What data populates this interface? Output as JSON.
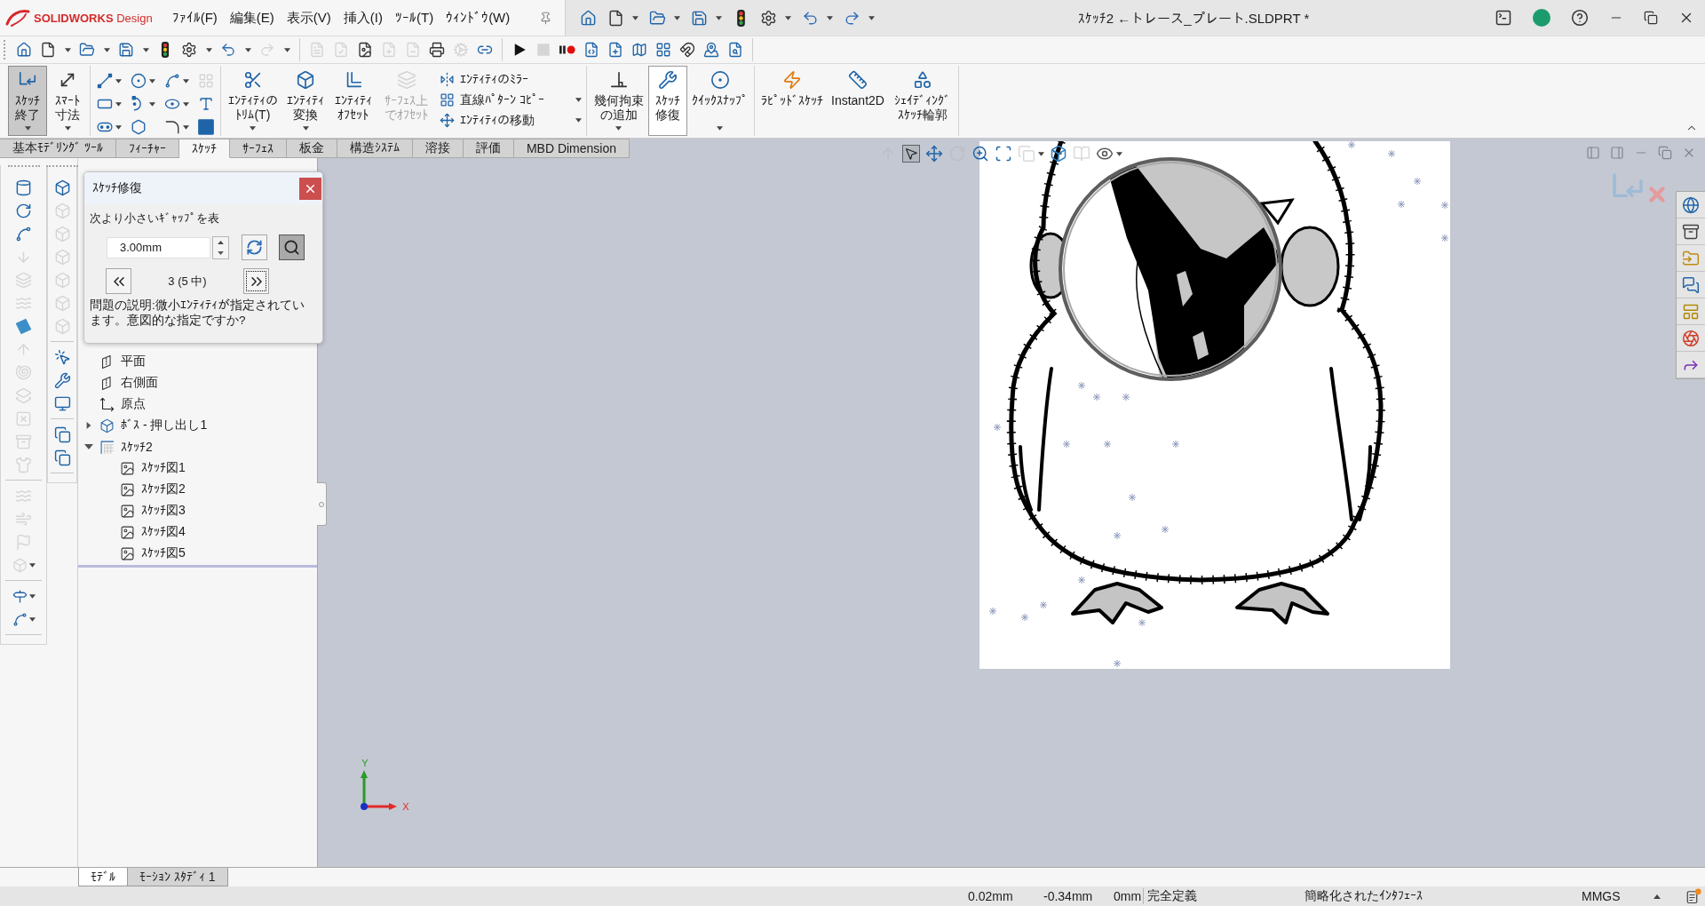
{
  "title_bar": {
    "app_name": "**SOLIDWORKS** Design",
    "menus": [
      "ﾌｧｲﾙ(F)",
      "編集(E)",
      "表示(V)",
      "挿入(I)",
      "ﾂｰﾙ(T)",
      "ｳｨﾝﾄﾞｳ(W)"
    ],
    "quick_access": [
      {
        "kind": "home",
        "dropdown": false
      },
      {
        "kind": "new",
        "dropdown": true
      },
      {
        "kind": "open",
        "dropdown": true
      },
      {
        "kind": "save",
        "dropdown": true
      },
      {
        "kind": "rebuild",
        "dropdown": false
      },
      {
        "kind": "options",
        "dropdown": true
      },
      {
        "kind": "undo",
        "dropdown": true
      },
      {
        "kind": "redo",
        "dropdown": true
      }
    ],
    "document_title": "ｽｹｯﾁ2 ←トレース_プレート.SLDPRT *"
  },
  "toolbar": {
    "groups": [
      [
        {
          "kind": "home",
          "dropdown": false,
          "disabled": false
        },
        {
          "kind": "new",
          "dropdown": true,
          "disabled": false
        },
        {
          "kind": "open",
          "dropdown": true,
          "disabled": false
        },
        {
          "kind": "save",
          "dropdown": true,
          "disabled": false
        },
        {
          "kind": "rebuild",
          "dropdown": false,
          "disabled": false
        },
        {
          "kind": "options",
          "dropdown": true,
          "disabled": false
        },
        {
          "kind": "undo",
          "dropdown": true,
          "disabled": false
        },
        {
          "kind": "redo",
          "dropdown": true,
          "disabled": true
        }
      ],
      [
        {
          "kind": "note",
          "disabled": true
        },
        {
          "kind": "note-check",
          "disabled": true
        },
        {
          "kind": "image-file",
          "disabled": false
        },
        {
          "kind": "add-file",
          "disabled": true
        },
        {
          "kind": "remove-file",
          "disabled": true
        },
        {
          "kind": "print",
          "disabled": false
        },
        {
          "kind": "cog",
          "disabled": true
        },
        {
          "kind": "link",
          "disabled": false
        }
      ],
      [
        {
          "kind": "play",
          "disabled": false
        },
        {
          "kind": "stop",
          "disabled": true
        },
        {
          "kind": "record",
          "disabled": false
        },
        {
          "kind": "macro-edit",
          "disabled": false
        },
        {
          "kind": "macro-new",
          "disabled": false
        },
        {
          "kind": "map",
          "disabled": false
        },
        {
          "kind": "layout",
          "disabled": false
        },
        {
          "kind": "magnet",
          "disabled": false
        },
        {
          "kind": "map-pin",
          "disabled": false
        },
        {
          "kind": "search-file",
          "disabled": false
        }
      ]
    ]
  },
  "ribbon": {
    "groups": [
      {
        "buttons": [
          {
            "kind": "exit-sketch",
            "label": "ｽｹｯﾁ終了",
            "selected": true,
            "highlighted": false,
            "disabled": false,
            "dropdown": true
          },
          {
            "kind": "smart-dimension",
            "label": "ｽﾏｰﾄ寸法",
            "selected": false,
            "highlighted": false,
            "disabled": false,
            "dropdown": true
          }
        ]
      },
      {
        "grid": [
          {
            "kind": "line",
            "disabled": false,
            "dropdown": true
          },
          {
            "kind": "circle",
            "disabled": false,
            "dropdown": true
          },
          {
            "kind": "spline",
            "disabled": false,
            "dropdown": true
          },
          {
            "kind": "sketch-grid",
            "disabled": true,
            "dropdown": false
          },
          {
            "kind": "rectangle",
            "disabled": false,
            "dropdown": true
          },
          {
            "kind": "arc",
            "disabled": false,
            "dropdown": true
          },
          {
            "kind": "ellipse",
            "disabled": false,
            "dropdown": true
          },
          {
            "kind": "text",
            "disabled": false,
            "dropdown": false
          },
          {
            "kind": "slot",
            "disabled": false,
            "dropdown": true
          },
          {
            "kind": "polygon",
            "disabled": false,
            "dropdown": false
          },
          {
            "kind": "fillet",
            "disabled": false,
            "dropdown": true
          },
          {
            "kind": "point",
            "disabled": false,
            "dropdown": false
          }
        ]
      },
      {
        "buttons": [
          {
            "kind": "trim",
            "label": "ｴﾝﾃｨﾃｨのﾄﾘﾑ(T)",
            "selected": false,
            "highlighted": false,
            "disabled": false,
            "dropdown": true
          },
          {
            "kind": "convert",
            "label": "ｴﾝﾃｨﾃｨ変換",
            "selected": false,
            "highlighted": false,
            "disabled": false,
            "dropdown": true
          },
          {
            "kind": "offset",
            "label": "ｴﾝﾃｨﾃｨｵﾌｾｯﾄ",
            "selected": false,
            "highlighted": false,
            "disabled": false,
            "dropdown": false
          },
          {
            "kind": "surface-offset",
            "label": "ｻｰﾌｪｽ上でｵﾌｾｯﾄ",
            "selected": false,
            "highlighted": false,
            "disabled": true,
            "dropdown": false
          }
        ],
        "list": [
          {
            "kind": "mirror",
            "label": "ｴﾝﾃｨﾃｨのﾐﾗｰ",
            "disabled": false,
            "dropdown": false
          },
          {
            "kind": "linear-pattern",
            "label": "直線ﾊﾟﾀｰﾝ ｺﾋﾟｰ",
            "disabled": false,
            "dropdown": true
          },
          {
            "kind": "move",
            "label": "ｴﾝﾃｨﾃｨの移動",
            "disabled": false,
            "dropdown": true
          }
        ]
      },
      {
        "buttons": [
          {
            "kind": "relation",
            "label": "幾何拘束の追加",
            "selected": false,
            "highlighted": false,
            "disabled": false,
            "dropdown": true
          },
          {
            "kind": "repair",
            "label": "ｽｹｯﾁ修復",
            "selected": false,
            "highlighted": true,
            "disabled": false,
            "dropdown": false
          },
          {
            "kind": "quick-snap",
            "label": "ｸｲｯｸｽﾅｯﾌﾟ",
            "selected": false,
            "highlighted": false,
            "disabled": false,
            "dropdown": true
          }
        ]
      },
      {
        "buttons": [
          {
            "kind": "rapid-sketch",
            "label": "ﾗﾋﾟｯﾄﾞｽｹｯﾁ",
            "selected": false,
            "highlighted": false,
            "disabled": false,
            "dropdown": false
          },
          {
            "kind": "instant2d",
            "label": "Instant2D",
            "selected": false,
            "highlighted": false,
            "disabled": false,
            "dropdown": false
          },
          {
            "kind": "shaded-contour",
            "label": "ｼｪｲﾃﾞｨﾝｸﾞｽｹｯﾁ輪郭",
            "selected": false,
            "highlighted": false,
            "disabled": false,
            "dropdown": false
          }
        ]
      }
    ]
  },
  "command_tabs": [
    {
      "label": "基本ﾓﾃﾞﾘﾝｸﾞ ﾂｰﾙ",
      "selected": false
    },
    {
      "label": "ﾌｨｰﾁｬｰ",
      "selected": false
    },
    {
      "label": "ｽｹｯﾁ",
      "selected": true
    },
    {
      "label": "ｻｰﾌｪｽ",
      "selected": false
    },
    {
      "label": "板金",
      "selected": false
    },
    {
      "label": "構造ｼｽﾃﾑ",
      "selected": false
    },
    {
      "label": "溶接",
      "selected": false
    },
    {
      "label": "評価",
      "selected": false
    },
    {
      "label": "MBD Dimension",
      "selected": false
    }
  ],
  "feature_toolbar": [
    [
      {
        "kind": "extrude",
        "disabled": false,
        "dropdown": false
      },
      {
        "kind": "revolve",
        "disabled": false,
        "dropdown": false
      },
      {
        "kind": "sweep",
        "disabled": false,
        "dropdown": false
      },
      {
        "kind": "drop",
        "disabled": true,
        "dropdown": false
      },
      {
        "kind": "loft",
        "disabled": true,
        "dropdown": false
      },
      {
        "kind": "boundary",
        "disabled": true,
        "dropdown": false
      },
      {
        "kind": "plane-surface",
        "disabled": false,
        "dropdown": false
      },
      {
        "kind": "dome",
        "disabled": true,
        "dropdown": false
      },
      {
        "kind": "shell",
        "disabled": true,
        "dropdown": false
      },
      {
        "kind": "bend",
        "disabled": true,
        "dropdown": false
      },
      {
        "kind": "delete-face",
        "disabled": true,
        "dropdown": false
      },
      {
        "kind": "stack",
        "disabled": true,
        "dropdown": false
      },
      {
        "kind": "vest",
        "disabled": true,
        "dropdown": false
      }
    ],
    [
      {
        "kind": "fill",
        "disabled": true,
        "dropdown": false
      },
      {
        "kind": "wave",
        "disabled": true,
        "dropdown": false
      },
      {
        "kind": "flag",
        "disabled": true,
        "dropdown": false
      },
      {
        "kind": "box",
        "disabled": true,
        "dropdown": true
      }
    ],
    [
      {
        "kind": "signpost",
        "disabled": false,
        "dropdown": true
      },
      {
        "kind": "curve",
        "disabled": false,
        "dropdown": true
      }
    ]
  ],
  "sketch_toolbar": [
    [
      {
        "kind": "view-cube",
        "disabled": false
      },
      {
        "kind": "view-cube",
        "disabled": true
      },
      {
        "kind": "view-cube",
        "disabled": true
      },
      {
        "kind": "view-cube",
        "disabled": true
      },
      {
        "kind": "view-cube",
        "disabled": true
      },
      {
        "kind": "view-cube",
        "disabled": true
      },
      {
        "kind": "view-cube",
        "disabled": true
      }
    ],
    [
      {
        "kind": "sketch-select",
        "disabled": false
      },
      {
        "kind": "repair",
        "disabled": false
      },
      {
        "kind": "monitor",
        "disabled": false
      }
    ],
    [
      {
        "kind": "copy",
        "disabled": false
      },
      {
        "kind": "copy",
        "disabled": false
      }
    ]
  ],
  "feature_tree": [
    {
      "label": "平面",
      "kind": "plane"
    },
    {
      "label": "右側面",
      "kind": "plane"
    },
    {
      "label": "原点",
      "kind": "origin"
    },
    {
      "label": "ﾎﾞｽ - 押し出し1",
      "kind": "extrude",
      "expanded": false
    },
    {
      "label": "ｽｹｯﾁ2",
      "kind": "sketch",
      "expanded": true,
      "children": [
        {
          "label": "ｽｹｯﾁ図1",
          "kind": "picture"
        },
        {
          "label": "ｽｹｯﾁ図2",
          "kind": "picture"
        },
        {
          "label": "ｽｹｯﾁ図3",
          "kind": "picture"
        },
        {
          "label": "ｽｹｯﾁ図4",
          "kind": "picture"
        },
        {
          "label": "ｽｹｯﾁ図5",
          "kind": "picture"
        }
      ]
    }
  ],
  "repair_dialog": {
    "title": "ｽｹｯﾁ修復",
    "gap_label": "次より小さいｷﾞｬｯﾌﾟを表",
    "gap_value": "3.00mm",
    "magnify_selected": true,
    "counter": "3 (5 中)",
    "next_focused": true,
    "description": "問題の説明:微小ｴﾝﾃｨﾃｨが指定されています。意図的な指定ですか?"
  },
  "viewport": {
    "view_toolbar": [
      {
        "kind": "axis",
        "disabled": true,
        "selected": false,
        "dropdown": false
      },
      {
        "kind": "select",
        "disabled": false,
        "selected": true,
        "dropdown": false
      },
      {
        "kind": "pan",
        "disabled": false,
        "selected": false,
        "dropdown": false
      },
      {
        "kind": "rotate",
        "disabled": true,
        "selected": false,
        "dropdown": false
      },
      {
        "kind": "zoom-fit",
        "disabled": false,
        "selected": false,
        "dropdown": false
      },
      {
        "kind": "zoom-area",
        "disabled": false,
        "selected": false,
        "dropdown": false
      },
      {
        "kind": "previous-view",
        "disabled": true,
        "selected": false,
        "dropdown": true
      },
      {
        "kind": "view-orientation",
        "disabled": false,
        "selected": false,
        "dropdown": false
      },
      {
        "kind": "display-style",
        "disabled": true,
        "selected": false,
        "dropdown": false
      },
      {
        "kind": "hide-show",
        "disabled": false,
        "selected": false,
        "dropdown": true
      }
    ],
    "triad": {
      "x_label": "X",
      "y_label": "Y"
    }
  },
  "bottom_tabs": [
    {
      "label": "ﾓﾃﾞﾙ",
      "selected": true
    },
    {
      "label": "ﾓｰｼｮﾝ ｽﾀﾃﾞｨ 1",
      "selected": false
    }
  ],
  "status_bar": {
    "readings": [
      "0.02mm",
      "-0.34mm",
      "0mm"
    ],
    "sketch_status": "完全定義",
    "interface": "簡略化されたｲﾝﾀﾌｪｰｽ",
    "units": "MMGS",
    "unread_notifications": true
  }
}
